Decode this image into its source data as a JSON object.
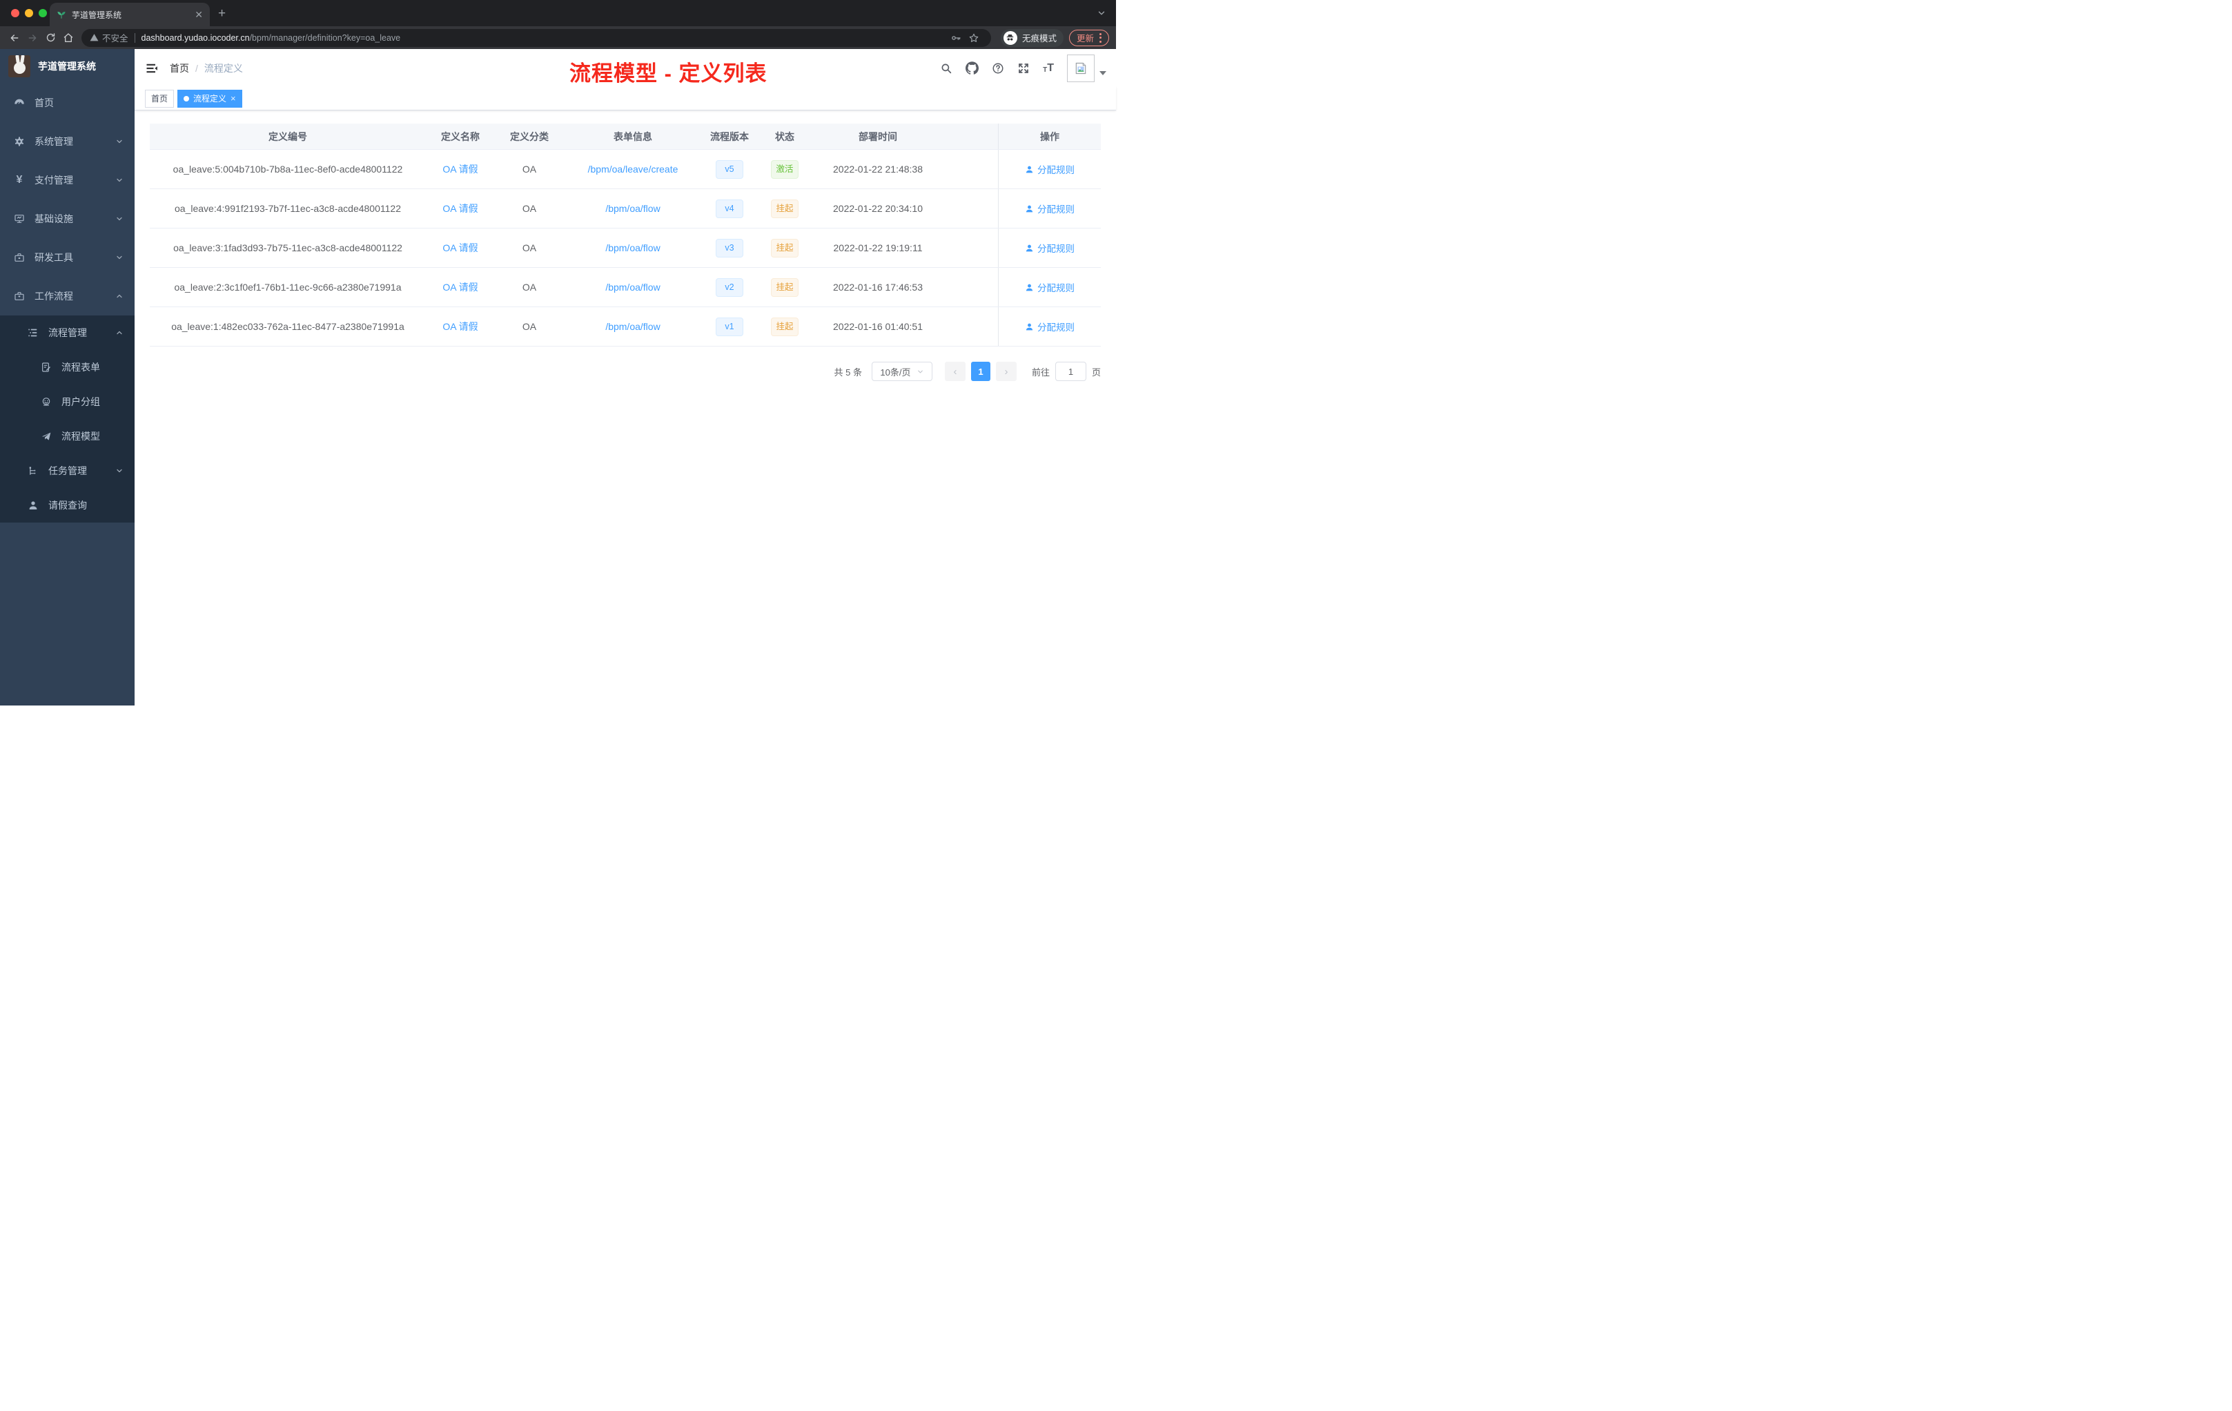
{
  "colors": {
    "accent": "#409eff",
    "success": "#67c23a",
    "warning": "#e6a23c",
    "annotation_red": "#f5291d",
    "sidebar_bg": "#304156",
    "submenu_bg": "#1f2d3d"
  },
  "browser": {
    "tab_title": "芋道管理系统",
    "not_secure_label": "不安全",
    "url_domain": "dashboard.yudao.iocoder.cn",
    "url_path": "/bpm/manager/definition?key=oa_leave",
    "incognito_label": "无痕模式",
    "update_label": "更新"
  },
  "sidebar": {
    "logo_title": "芋道管理系统",
    "items": [
      {
        "label": "首页"
      },
      {
        "label": "系统管理"
      },
      {
        "label": "支付管理"
      },
      {
        "label": "基础设施"
      },
      {
        "label": "研发工具"
      },
      {
        "label": "工作流程"
      },
      {
        "label": "流程管理"
      },
      {
        "label": "流程表单"
      },
      {
        "label": "用户分组"
      },
      {
        "label": "流程模型"
      },
      {
        "label": "任务管理"
      },
      {
        "label": "请假查询"
      }
    ]
  },
  "header": {
    "breadcrumb_home": "首页",
    "breadcrumb_current": "流程定义",
    "annotation": "流程模型 - 定义列表"
  },
  "tags": [
    {
      "label": "首页",
      "active": false
    },
    {
      "label": "流程定义",
      "active": true
    }
  ],
  "table": {
    "columns": [
      "定义编号",
      "定义名称",
      "定义分类",
      "表单信息",
      "流程版本",
      "状态",
      "部署时间",
      "操作"
    ],
    "rows": [
      {
        "id": "oa_leave:5:004b710b-7b8a-11ec-8ef0-acde48001122",
        "name": "OA 请假",
        "category": "OA",
        "form": "/bpm/oa/leave/create",
        "version": "v5",
        "status": "激活",
        "status_type": "success",
        "deploy_time": "2022-01-22 21:48:38",
        "action": "分配规则"
      },
      {
        "id": "oa_leave:4:991f2193-7b7f-11ec-a3c8-acde48001122",
        "name": "OA 请假",
        "category": "OA",
        "form": "/bpm/oa/flow",
        "version": "v4",
        "status": "挂起",
        "status_type": "warning",
        "deploy_time": "2022-01-22 20:34:10",
        "action": "分配规则"
      },
      {
        "id": "oa_leave:3:1fad3d93-7b75-11ec-a3c8-acde48001122",
        "name": "OA 请假",
        "category": "OA",
        "form": "/bpm/oa/flow",
        "version": "v3",
        "status": "挂起",
        "status_type": "warning",
        "deploy_time": "2022-01-22 19:19:11",
        "action": "分配规则"
      },
      {
        "id": "oa_leave:2:3c1f0ef1-76b1-11ec-9c66-a2380e71991a",
        "name": "OA 请假",
        "category": "OA",
        "form": "/bpm/oa/flow",
        "version": "v2",
        "status": "挂起",
        "status_type": "warning",
        "deploy_time": "2022-01-16 17:46:53",
        "action": "分配规则"
      },
      {
        "id": "oa_leave:1:482ec033-762a-11ec-8477-a2380e71991a",
        "name": "OA 请假",
        "category": "OA",
        "form": "/bpm/oa/flow",
        "version": "v1",
        "status": "挂起",
        "status_type": "warning",
        "deploy_time": "2022-01-16 01:40:51",
        "action": "分配规则"
      }
    ]
  },
  "pagination": {
    "total_label": "共 5 条",
    "page_size_label": "10条/页",
    "current_page": "1",
    "goto_label": "前往",
    "goto_value": "1",
    "page_unit_label": "页"
  }
}
